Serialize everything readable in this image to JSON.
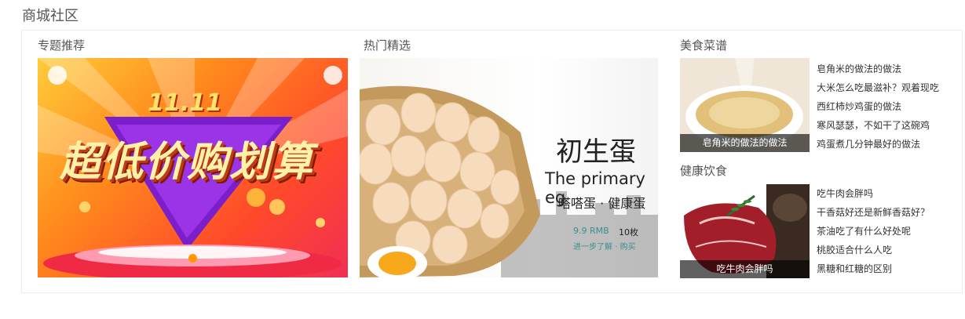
{
  "page": {
    "title": "商城社区"
  },
  "topics": {
    "title": "专题推荐",
    "banner": {
      "headline_top": "11.11",
      "headline": "超低价购划算"
    }
  },
  "hot": {
    "title": "热门精选",
    "banner": {
      "headline": "初生蛋",
      "english": "The primary eg",
      "sub": "嗒嗒蛋 · 健康蛋",
      "price": "9.9 RMB",
      "count": "10枚",
      "slogan": "进一步了解 · 购买"
    }
  },
  "food": {
    "title": "美食菜谱",
    "caption": "皂角米的做法的做法",
    "items": [
      "皂角米的做法的做法",
      "大米怎么吃最滋补？观着现吃",
      "西红柿炒鸡蛋的做法",
      "寒风瑟瑟，不如干了这碗鸡",
      "鸡蛋煮几分钟最好的做法"
    ]
  },
  "health": {
    "title": "健康饮食",
    "caption": "吃牛肉会胖吗",
    "items": [
      "吃牛肉会胖吗",
      "干香菇好还是新鲜香菇好？",
      "茶油吃了有什么好处呢",
      "桃胶适合什么人吃",
      "黑糖和红糖的区别"
    ]
  },
  "colors": {
    "accent": "#ff9700",
    "caption_bg": "#000000"
  }
}
